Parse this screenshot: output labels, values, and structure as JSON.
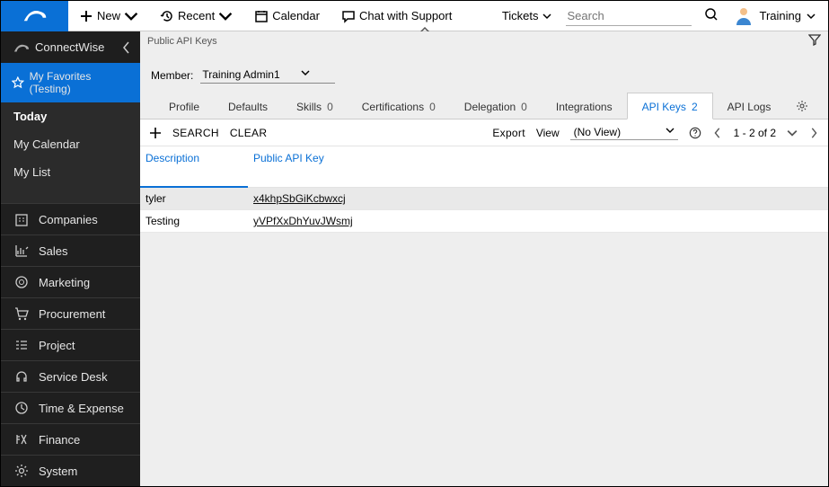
{
  "topbar": {
    "new": "New",
    "recent": "Recent",
    "calendar": "Calendar",
    "chat": "Chat with Support",
    "tickets": "Tickets",
    "search_placeholder": "Search",
    "user": "Training"
  },
  "sidebar": {
    "brand": "ConnectWise",
    "favorites": "My Favorites (Testing)",
    "sub": {
      "today": "Today",
      "cal": "My Calendar",
      "list": "My List"
    },
    "nav": {
      "companies": "Companies",
      "sales": "Sales",
      "marketing": "Marketing",
      "procurement": "Procurement",
      "project": "Project",
      "servicedesk": "Service Desk",
      "time": "Time & Expense",
      "finance": "Finance",
      "system": "System"
    }
  },
  "breadcrumb": "Public API Keys",
  "member": {
    "label": "Member:",
    "value": "Training Admin1"
  },
  "tabs": {
    "profile": "Profile",
    "defaults": "Defaults",
    "skills": "Skills",
    "skills_cnt": "0",
    "certs": "Certifications",
    "certs_cnt": "0",
    "delegation": "Delegation",
    "delegation_cnt": "0",
    "integrations": "Integrations",
    "apikeys": "API Keys",
    "apikeys_cnt": "2",
    "apilogs": "API Logs"
  },
  "toolbar": {
    "search": "SEARCH",
    "clear": "CLEAR",
    "export": "Export",
    "view": "View",
    "view_value": "(No View)",
    "pagination": "1 - 2 of 2"
  },
  "columns": {
    "desc": "Description",
    "key": "Public API Key"
  },
  "rows": [
    {
      "desc": "tyler",
      "key": "x4khpSbGiKcbwxcj"
    },
    {
      "desc": "Testing",
      "key": "yVPfXxDhYuvJWsmj"
    }
  ]
}
